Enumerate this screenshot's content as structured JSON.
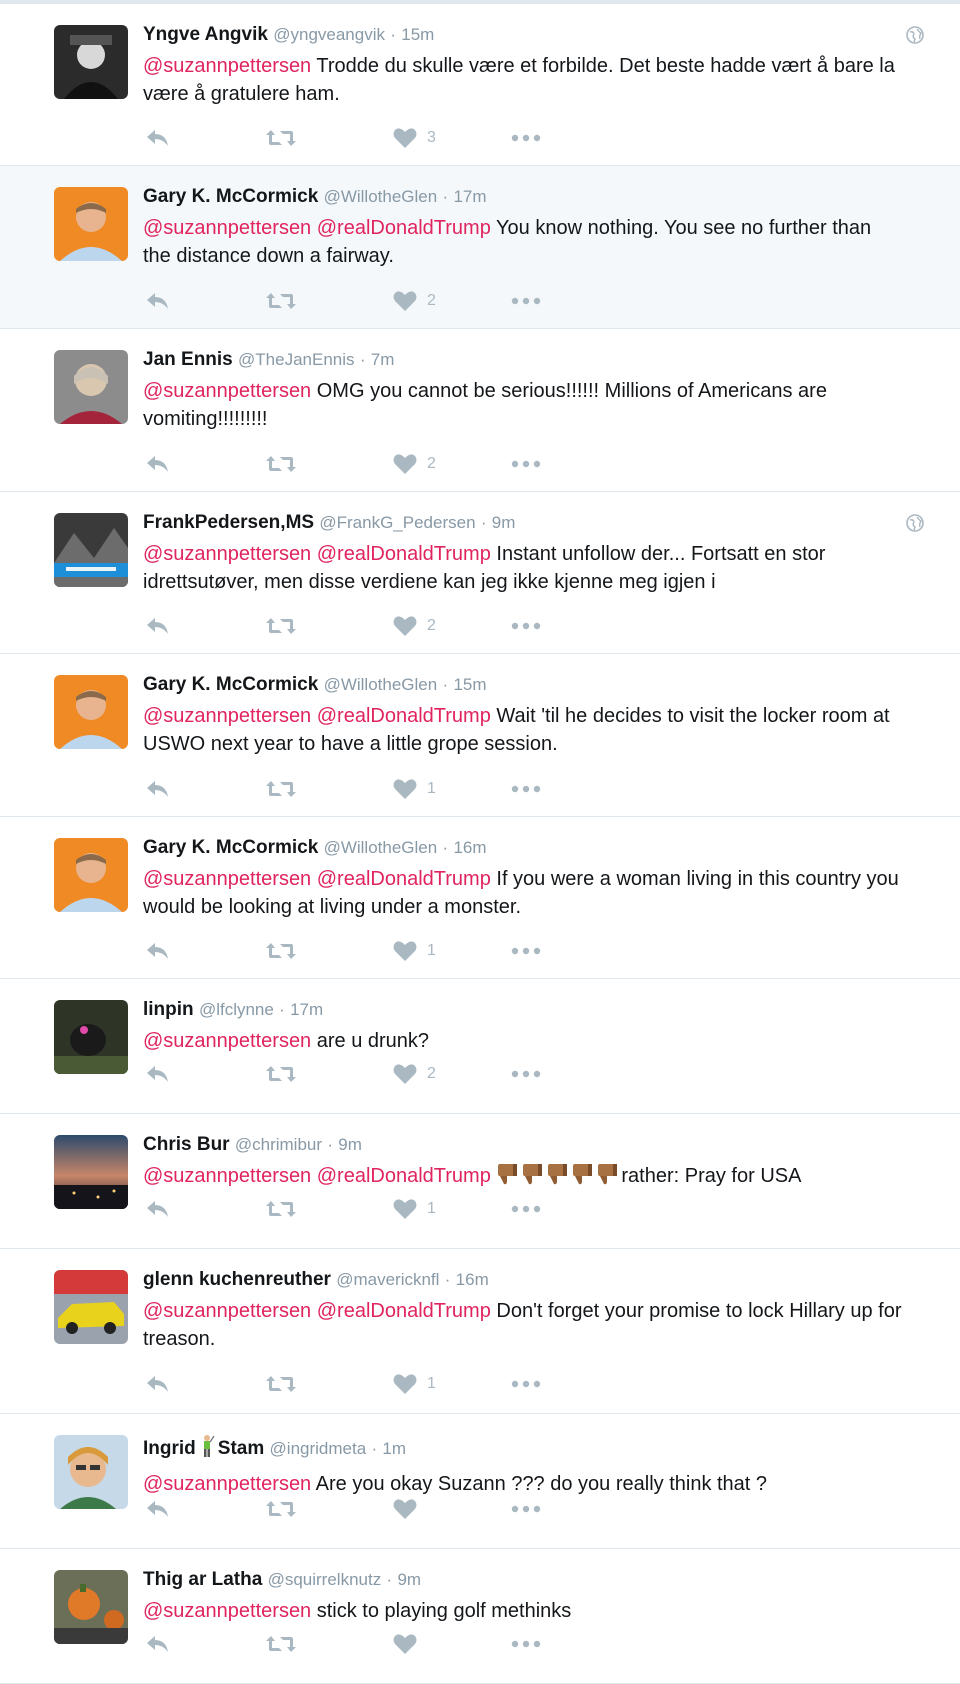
{
  "tweets": [
    {
      "fullname": "Yngve Angvik",
      "username": "@yngveangvik",
      "time": "15m",
      "mention1": "@suzannpettersen",
      "mention2": "",
      "body": " Trodde du skulle være et forbilde. Det beste hadde vært å bare la være å gratulere ham.",
      "likes": "3",
      "globe": true
    },
    {
      "fullname": "Gary K. McCormick",
      "username": "@WillotheGlen",
      "time": "17m",
      "mention1": "@suzannpettersen",
      "mention2": "@realDonaldTrump",
      "body": " You know nothing. You see no further than the distance down a fairway.",
      "likes": "2",
      "globe": false
    },
    {
      "fullname": "Jan Ennis",
      "username": "@TheJanEnnis",
      "time": "7m",
      "mention1": "@suzannpettersen",
      "mention2": "",
      "body": " OMG you cannot be serious!!!!!! Millions of Americans are vomiting!!!!!!!!!",
      "likes": "2",
      "globe": false
    },
    {
      "fullname": "FrankPedersen,MS",
      "username": "@FrankG_Pedersen",
      "time": "9m",
      "mention1": "@suzannpettersen",
      "mention2": "@realDonaldTrump",
      "body": " Instant unfollow der... Fortsatt en stor idrettsutøver, men disse verdiene kan jeg ikke kjenne meg igjen i",
      "likes": "2",
      "globe": true
    },
    {
      "fullname": "Gary K. McCormick",
      "username": "@WillotheGlen",
      "time": "15m",
      "mention1": "@suzannpettersen",
      "mention2": "@realDonaldTrump",
      "body": " Wait 'til he decides to visit the locker room at USWO next year to have a little grope session.",
      "likes": "1",
      "globe": false
    },
    {
      "fullname": "Gary K. McCormick",
      "username": "@WillotheGlen",
      "time": "16m",
      "mention1": "@suzannpettersen",
      "mention2": "@realDonaldTrump",
      "body": " If you were a woman living in this country you would be looking at living under a monster.",
      "likes": "1",
      "globe": false
    },
    {
      "fullname": "linpin",
      "username": "@lfclynne",
      "time": "17m",
      "mention1": "@suzannpettersen",
      "mention2": "",
      "body": " are u drunk?",
      "likes": "2",
      "globe": false
    },
    {
      "fullname": "Chris Bur",
      "username": "@chrimibur",
      "time": "9m",
      "mention1": "@suzannpettersen",
      "mention2": "@realDonaldTrump",
      "body": "rather: Pray for USA",
      "likes": "1",
      "globe": false,
      "thumbs_down_count": 5
    },
    {
      "fullname": "glenn kuchenreuther",
      "username": "@mavericknfl",
      "time": "16m",
      "mention1": "@suzannpettersen",
      "mention2": "@realDonaldTrump",
      "body": " Don't forget your promise to lock Hillary up for treason.",
      "likes": "1",
      "globe": false
    },
    {
      "fullname": "Ingrid",
      "fullname2": "Stam",
      "username": "@ingridmeta",
      "time": "1m",
      "mention1": "@suzannpettersen",
      "mention2": "",
      "body": " Are you okay Suzann ??? do you really think that ?",
      "likes": "",
      "globe": false
    },
    {
      "fullname": "Thig ar Latha",
      "username": "@squirrelknutz",
      "time": "9m",
      "mention1": "@suzannpettersen",
      "mention2": "",
      "body": " stick to playing golf methinks",
      "likes": "",
      "globe": false
    }
  ],
  "separator": "·",
  "icons": {
    "reply": "reply-icon",
    "retweet": "retweet-icon",
    "like": "heart-icon",
    "more": "more-icon",
    "globe": "globe-icon",
    "thumbs_down": "thumbs-down-emoji",
    "golfer": "golfer-emoji"
  },
  "colors": {
    "mention": "#e0245e",
    "meta": "#8899a6",
    "action": "#aab8c2",
    "border": "#e1e8ed",
    "highlight_bg": "#f5f8fa"
  }
}
